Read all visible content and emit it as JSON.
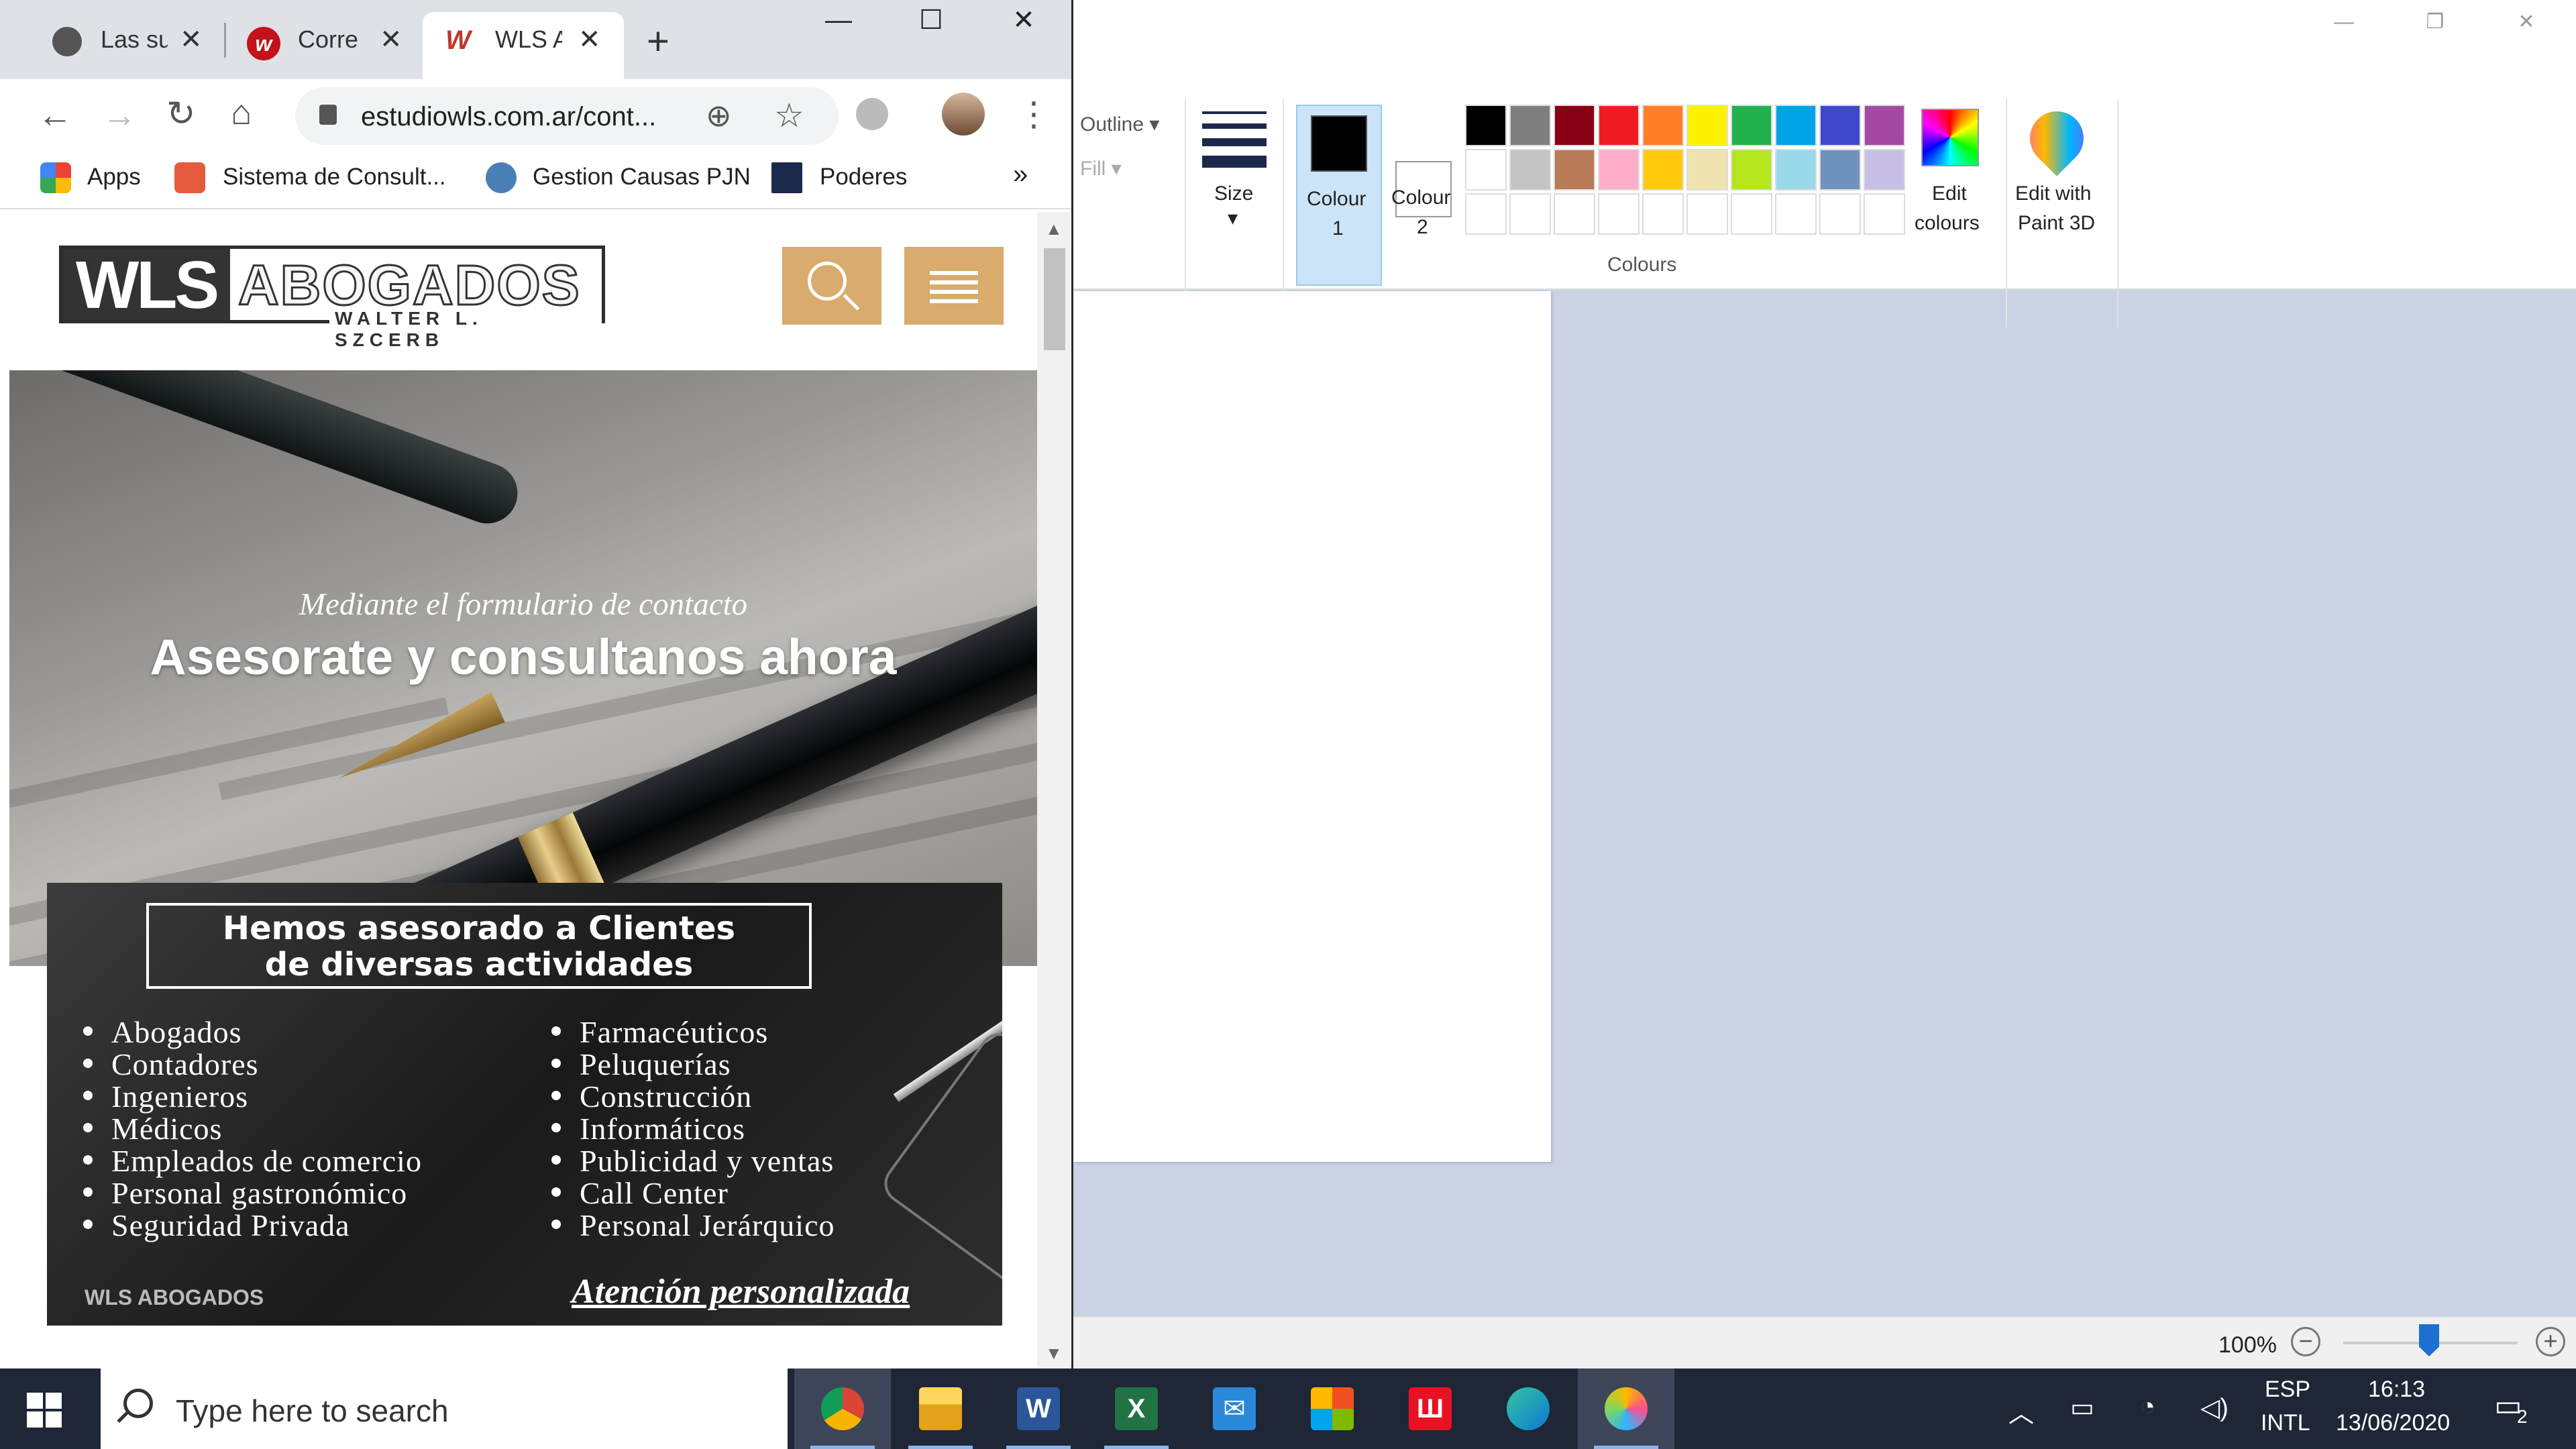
{
  "chrome": {
    "tabs": [
      {
        "title": "Las su"
      },
      {
        "title": "Corre"
      },
      {
        "title": "WLS A"
      }
    ],
    "new_tab": "+",
    "url": "estudiowls.com.ar/cont...",
    "bookmarks": [
      {
        "label": "Apps"
      },
      {
        "label": "Sistema de Consult..."
      },
      {
        "label": "Gestion Causas PJN"
      },
      {
        "label": "Poderes"
      }
    ],
    "more_bookmarks": "»"
  },
  "site": {
    "logo_main": "WLS",
    "logo_name": "ABOGADOS",
    "logo_sub": "WALTER L. SZCERB",
    "hero_subtitle": "Mediante el formulario de contacto",
    "hero_title": "Asesorate y consultanos ahora",
    "card": {
      "heading_1": "Hemos asesorado a Clientes",
      "heading_2": "de diversas actividades",
      "col1": [
        "Abogados",
        "Contadores",
        "Ingenieros",
        "Médicos",
        "Empleados de comercio",
        "Personal gastronómico",
        "Seguridad Privada"
      ],
      "col2": [
        "Farmacéuticos",
        "Peluquerías",
        "Construcción",
        "Informáticos",
        "Publicidad y ventas",
        "Call Center",
        "Personal Jerárquico"
      ],
      "footer_logo": "WLS ABOGADOS",
      "footer_tagline": "Atención personalizada"
    }
  },
  "paint": {
    "outline": "Outline",
    "fill": "Fill",
    "size": "Size",
    "colour1_a": "Colour",
    "colour1_b": "1",
    "colour2_a": "Colour",
    "colour2_b": "2",
    "edit_colours_a": "Edit",
    "edit_colours_b": "colours",
    "paint3d_a": "Edit with",
    "paint3d_b": "Paint 3D",
    "colours_group": "Colours",
    "zoom": "100%",
    "palette_row1": [
      "#000000",
      "#7f7f7f",
      "#880015",
      "#ed1c24",
      "#ff7f27",
      "#fff200",
      "#22b14c",
      "#00a2e8",
      "#3f48cc",
      "#a349a4"
    ],
    "palette_row2": [
      "#ffffff",
      "#c3c3c3",
      "#b97a57",
      "#ffaec9",
      "#ffc90e",
      "#efe4b0",
      "#b5e61d",
      "#99d9ea",
      "#7092be",
      "#c8bfe7"
    ]
  },
  "taskbar": {
    "search_placeholder": "Type here to search",
    "lang_1": "ESP",
    "lang_2": "INTL",
    "time": "16:13",
    "date": "13/06/2020",
    "notifications": "2"
  }
}
